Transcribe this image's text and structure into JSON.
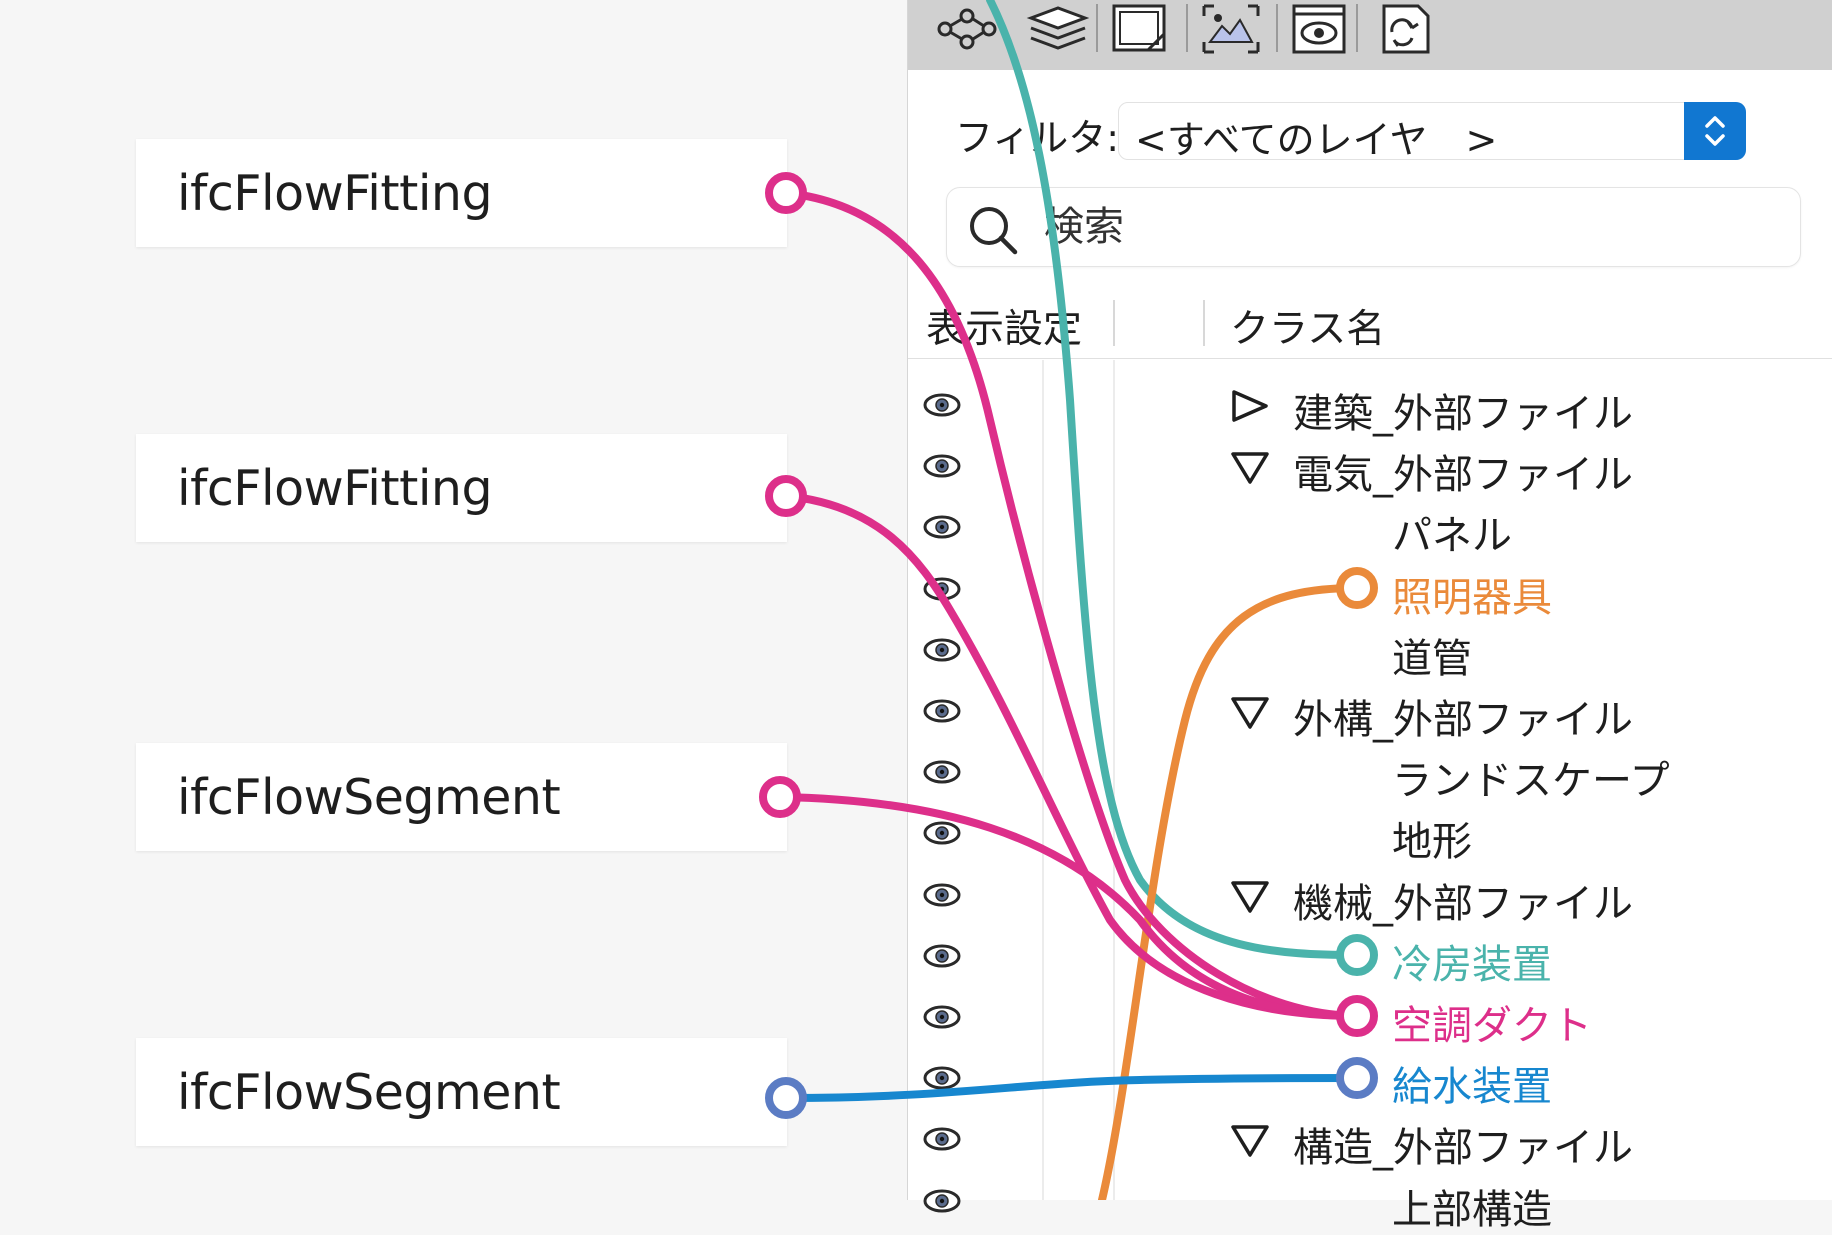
{
  "cards": [
    {
      "label": "ifcFlowFitting"
    },
    {
      "label": "ifcFlowFitting"
    },
    {
      "label": "ifcFlowSegment"
    },
    {
      "label": "ifcFlowSegment"
    }
  ],
  "panel": {
    "toolbar_icons": [
      "network-icon",
      "layers-icon",
      "layer-box-icon",
      "image-frame-icon",
      "eye-window-icon",
      "sync-document-icon"
    ],
    "filter": {
      "label": "フィルタ:",
      "value": "<すべてのレイヤ　>"
    },
    "search": {
      "placeholder": "検索"
    },
    "columns": {
      "visibility": "表示設定",
      "class_name": "クラス名"
    },
    "rows": [
      {
        "label": "建築_外部ファイル",
        "level": 0,
        "toggle": "collapsed"
      },
      {
        "label": "電気_外部ファイル",
        "level": 0,
        "toggle": "expanded"
      },
      {
        "label": "パネル",
        "level": 1
      },
      {
        "label": "照明器具",
        "level": 1,
        "color": "#ea8a3a"
      },
      {
        "label": "道管",
        "level": 1
      },
      {
        "label": "外構_外部ファイル",
        "level": 0,
        "toggle": "expanded"
      },
      {
        "label": "ランドスケープ",
        "level": 1
      },
      {
        "label": "地形",
        "level": 1
      },
      {
        "label": "機械_外部ファイル",
        "level": 0,
        "toggle": "expanded"
      },
      {
        "label": "冷房装置",
        "level": 1,
        "color": "#4ab3ab"
      },
      {
        "label": "空調ダクト",
        "level": 1,
        "color": "#dd2f8a"
      },
      {
        "label": "給水装置",
        "level": 1,
        "color": "#1787cf"
      },
      {
        "label": "構造_外部ファイル",
        "level": 0,
        "toggle": "expanded"
      },
      {
        "label": "上部構造",
        "level": 1
      }
    ]
  },
  "colors": {
    "magenta": "#dd2f8a",
    "teal": "#4ab3ab",
    "orange": "#ea8a3a",
    "blue": "#1787cf",
    "blue_node": "#5b7cc4"
  }
}
